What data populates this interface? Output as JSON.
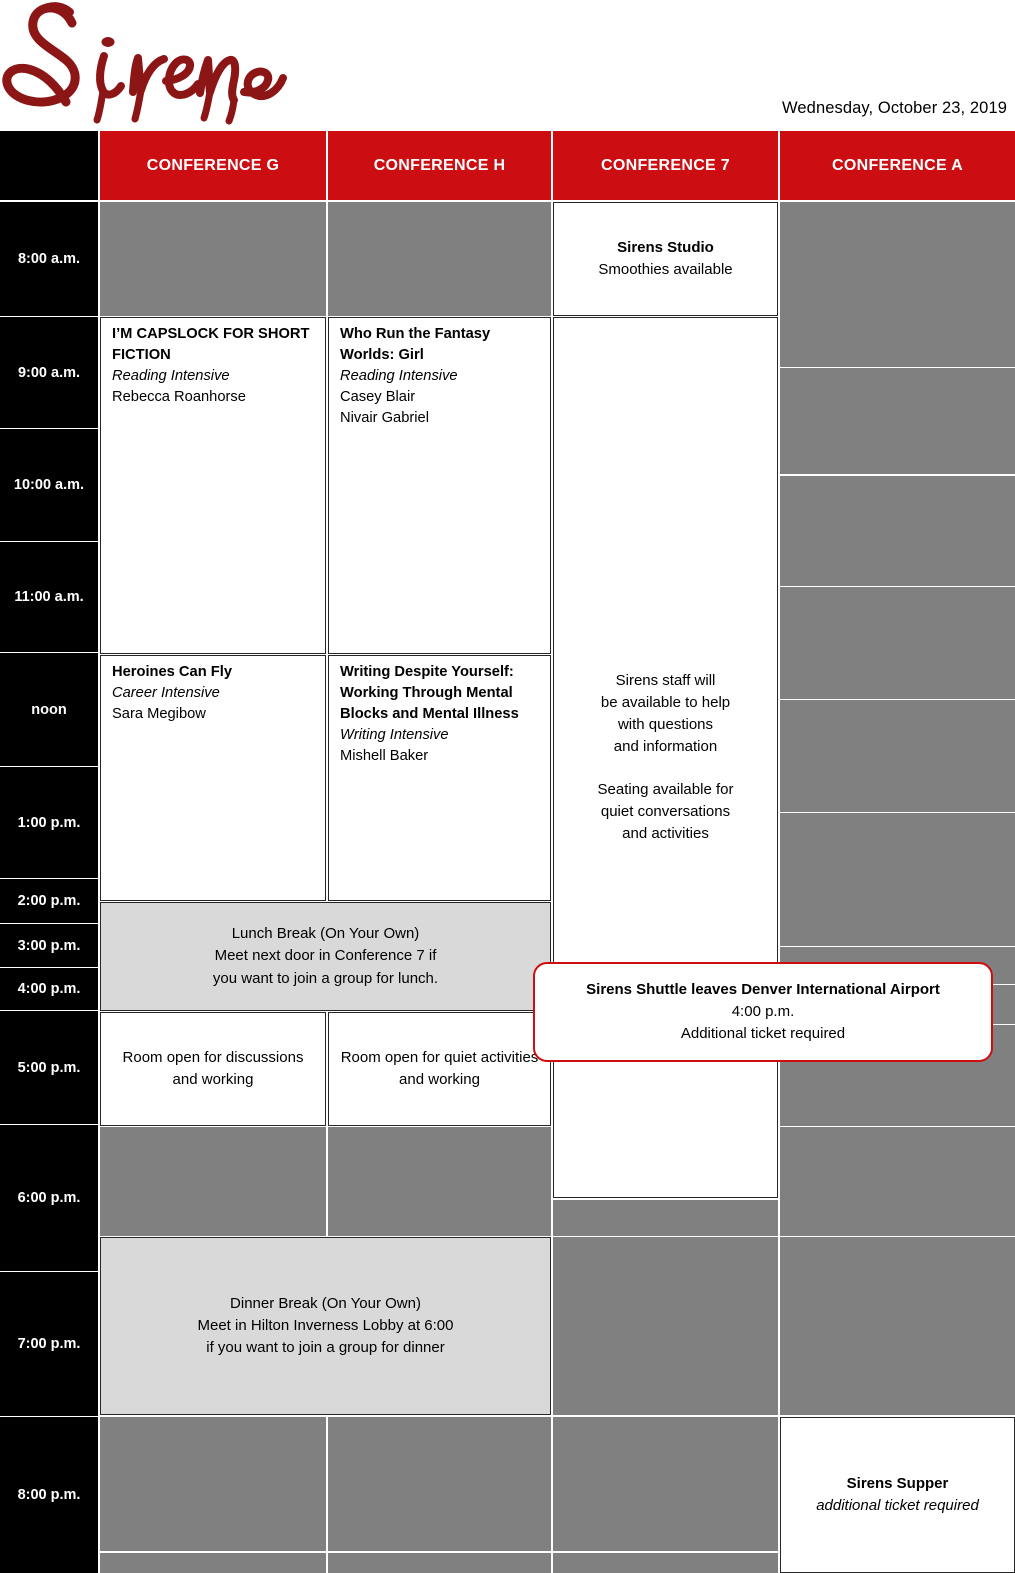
{
  "header": {
    "logo_text": "Sirens",
    "logo_color": "#8C1616",
    "date": "Wednesday, October 23, 2019",
    "accent_red": "#CC0D12",
    "gray_fill": "#808080",
    "light_gray_fill": "#D9D9D9"
  },
  "columns": [
    {
      "label": ""
    },
    {
      "label": "CONFERENCE G"
    },
    {
      "label": "CONFERENCE H"
    },
    {
      "label": "CONFERENCE 7"
    },
    {
      "label": "CONFERENCE A"
    }
  ],
  "times": [
    {
      "label": "8:00 a.m."
    },
    {
      "label": "9:00 a.m."
    },
    {
      "label": "10:00 a.m."
    },
    {
      "label": "11:00 a.m."
    },
    {
      "label": "noon"
    },
    {
      "label": "1:00 p.m."
    },
    {
      "label": "2:00 p.m."
    },
    {
      "label": "3:00 p.m."
    },
    {
      "label": "4:00 p.m."
    },
    {
      "label": "5:00 p.m."
    },
    {
      "label": "6:00 p.m."
    },
    {
      "label": "7:00 p.m."
    },
    {
      "label": "8:00 p.m."
    }
  ],
  "sessions": {
    "capslock": {
      "title": "I’M CAPSLOCK FOR SHORT FICTION",
      "track": "Reading Intensive",
      "person1": "Rebecca Roanhorse"
    },
    "who_run": {
      "title": "Who Run the Fantasy Worlds: Girl",
      "track": "Reading Intensive",
      "person1": "Casey Blair",
      "person2": "Nivair Gabriel"
    },
    "heroines": {
      "title": "Heroines Can Fly",
      "track": "Career Intensive",
      "person1": "Sara Megibow"
    },
    "writing_despite": {
      "title": "Writing Despite Yourself: Working Through Mental Blocks and Mental Illness",
      "track": "Writing Intensive",
      "person1": "Mishell Baker"
    },
    "sirens_studio": {
      "title": "Sirens Studio",
      "line1": "Smoothies available"
    },
    "staff_info": {
      "line1": "Sirens staff will",
      "line2": "be available to help",
      "line3": "with questions",
      "line4": "and information",
      "line5": "Seating available for",
      "line6": "quiet conversations",
      "line7": "and activities"
    },
    "lunch": {
      "line1": "Lunch Break (On Your Own)",
      "line2": "Meet next door in Conference 7 if",
      "line3": "you want to join a group for lunch."
    },
    "dinner": {
      "line1": "Dinner Break (On Your Own)",
      "line2": "Meet in Hilton Inverness Lobby at 6:00",
      "line3": "if you want to join a group for dinner"
    },
    "room_g": {
      "line1": "Room open for discussions",
      "line2": "and working"
    },
    "room_h": {
      "line1": "Room open for quiet activities",
      "line2": "and working"
    },
    "shuttle": {
      "title": "Sirens Shuttle leaves Denver International Airport",
      "line1": "4:00 p.m.",
      "line2": "Additional ticket required"
    },
    "supper": {
      "title": "Sirens Supper",
      "note": "additional ticket required"
    }
  }
}
